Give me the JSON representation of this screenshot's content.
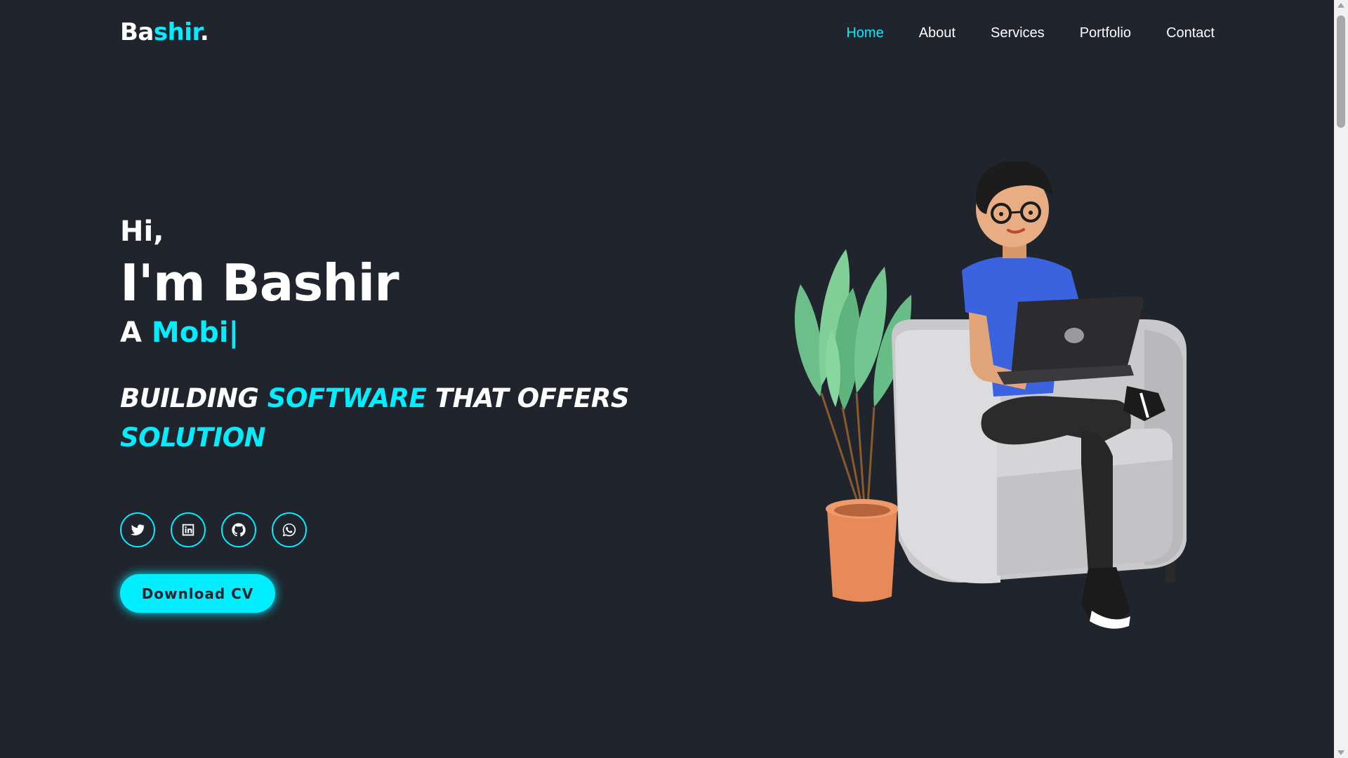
{
  "logo": {
    "prefix": "Ba",
    "accent": "shir",
    "suffix": "."
  },
  "nav": {
    "items": [
      {
        "label": "Home",
        "active": true
      },
      {
        "label": "About"
      },
      {
        "label": "Services"
      },
      {
        "label": "Portfolio"
      },
      {
        "label": "Contact"
      }
    ]
  },
  "hero": {
    "greeting": "Hi,",
    "name": "I'm Bashir",
    "role_prefix": "A",
    "role_typed": "Mobi",
    "cursor": "|",
    "tagline": {
      "part1": "BUILDING",
      "part2": "SOFTWARE",
      "part3": "THAT OFFERS",
      "part4": "SOLUTION"
    }
  },
  "social": [
    {
      "icon": "twitter-icon"
    },
    {
      "icon": "linkedin-icon"
    },
    {
      "icon": "github-icon"
    },
    {
      "icon": "whatsapp-icon"
    }
  ],
  "cta": {
    "label": "Download CV"
  },
  "colors": {
    "accent": "#00eeff",
    "background": "#1f242d",
    "text": "#ffffff"
  }
}
